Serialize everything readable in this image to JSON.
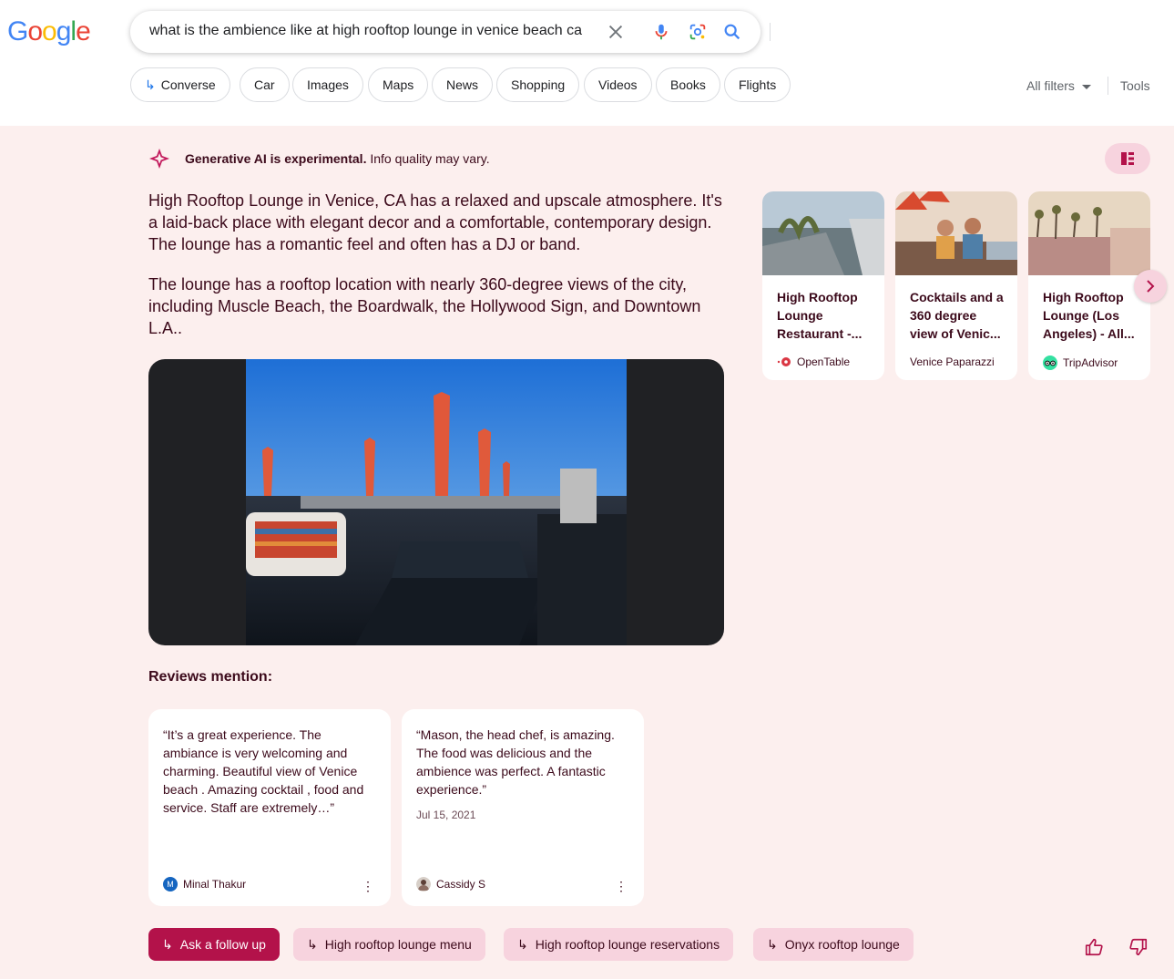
{
  "header": {
    "logo_letters": [
      "G",
      "o",
      "o",
      "g",
      "l",
      "e"
    ],
    "query": "what is the ambience like at high rooftop lounge in venice beach ca"
  },
  "chips": [
    {
      "label": "Converse",
      "arrow": "↳"
    },
    {
      "label": "Car"
    },
    {
      "label": "Images"
    },
    {
      "label": "Maps"
    },
    {
      "label": "News"
    },
    {
      "label": "Shopping"
    },
    {
      "label": "Videos"
    },
    {
      "label": "Books"
    },
    {
      "label": "Flights"
    }
  ],
  "filters": {
    "all_filters": "All filters",
    "tools": "Tools"
  },
  "ai": {
    "note_bold": "Generative AI is experimental.",
    "note_rest": " Info quality may vary.",
    "paragraphs": [
      "High Rooftop Lounge in Venice, CA has a relaxed and upscale atmosphere. It's a laid-back place with elegant decor and a comfortable, contemporary design. The lounge has a romantic feel and often has a DJ or band.",
      "The lounge has a rooftop location with nearly 360-degree views of the city, including Muscle Beach, the Boardwalk, the Hollywood Sign, and Downtown L.A.."
    ],
    "reviews_title": "Reviews mention:",
    "reviews": [
      {
        "text": "“It’s a great experience. The ambiance is very welcoming and charming. Beautiful view of Venice beach . Amazing cocktail , food and service. Staff are extremely…”",
        "date": "",
        "author": "Minal Thakur",
        "avatar_letter": "M"
      },
      {
        "text": "“Mason, the head chef, is amazing. The food was delicious and the ambience was perfect. A fantastic experience.”",
        "date": "Jul 15, 2021",
        "author": "Cassidy S",
        "avatar_letter": ""
      }
    ],
    "sources": [
      {
        "title": "High Rooftop Lounge Restaurant -...",
        "source": "OpenTable"
      },
      {
        "title": "Cocktails and a 360 degree view of Venic...",
        "source": "Venice Paparazzi"
      },
      {
        "title": "High Rooftop Lounge (Los Angeles) - All...",
        "source": "TripAdvisor"
      }
    ],
    "followups": [
      {
        "label": "Ask a follow up",
        "arrow": "↳"
      },
      {
        "label": "High rooftop lounge menu",
        "arrow": "↳"
      },
      {
        "label": "High rooftop lounge reservations",
        "arrow": "↳"
      },
      {
        "label": "Onyx rooftop lounge",
        "arrow": "↳"
      }
    ]
  },
  "colors": {
    "accent": "#b3124a",
    "panel_bg": "#fcefee",
    "chip_bg": "#f7d3de",
    "text": "#3c0a1b"
  }
}
